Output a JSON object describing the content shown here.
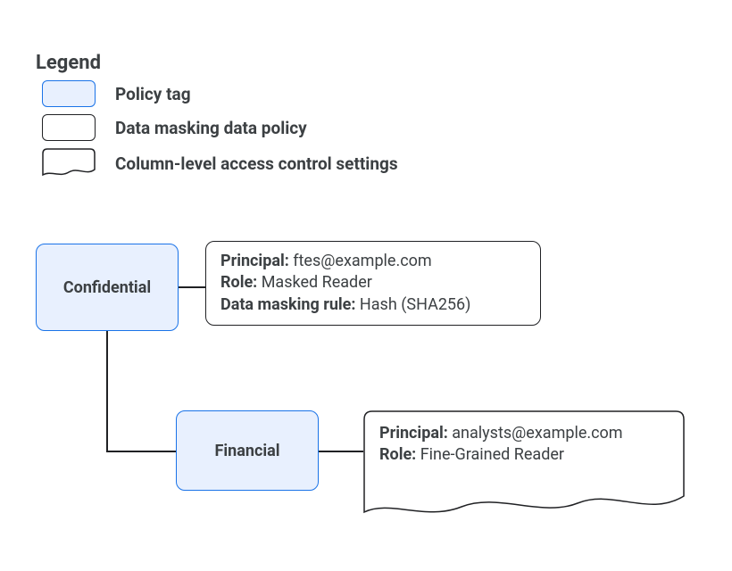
{
  "legend": {
    "title": "Legend",
    "items": [
      {
        "label": "Policy tag"
      },
      {
        "label": "Data masking data policy"
      },
      {
        "label": "Column-level access control settings"
      }
    ]
  },
  "tags": {
    "confidential": {
      "label": "Confidential",
      "masking_policy": {
        "principal_label": "Principal:",
        "principal_value": "ftes@example.com",
        "role_label": "Role:",
        "role_value": "Masked Reader",
        "rule_label": "Data masking rule:",
        "rule_value": "Hash (SHA256)"
      }
    },
    "financial": {
      "label": "Financial",
      "access_settings": {
        "principal_label": "Principal:",
        "principal_value": "analysts@example.com",
        "role_label": "Role:",
        "role_value": "Fine-Grained Reader"
      }
    }
  },
  "colors": {
    "tag_fill": "#e8f0fe",
    "tag_border": "#1a73e8",
    "box_border": "#202124",
    "text": "#3c4043"
  }
}
